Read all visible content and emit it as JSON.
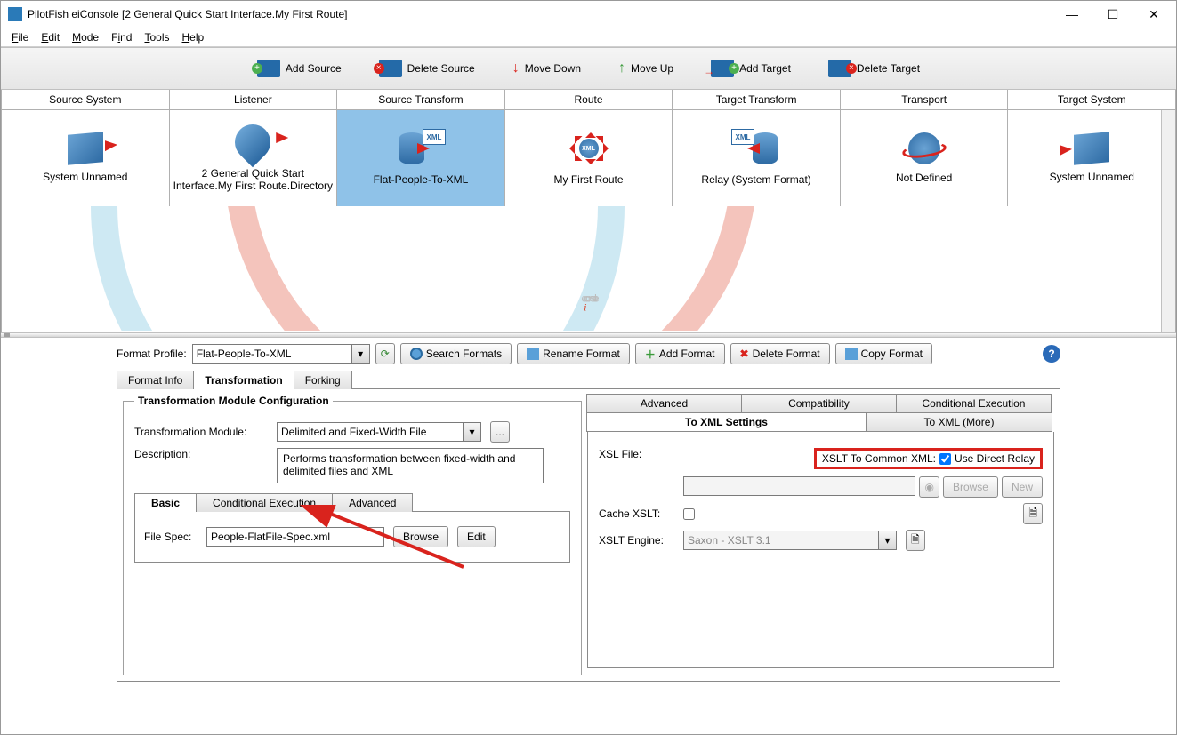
{
  "window": {
    "title": "PilotFish eiConsole [2 General Quick Start Interface.My First Route]"
  },
  "menu": {
    "file": "File",
    "edit": "Edit",
    "mode": "Mode",
    "find": "Find",
    "tools": "Tools",
    "help": "Help"
  },
  "toolbar": {
    "addSource": "Add Source",
    "deleteSource": "Delete Source",
    "moveDown": "Move Down",
    "moveUp": "Move Up",
    "addTarget": "Add Target",
    "deleteTarget": "Delete Target"
  },
  "stages": {
    "headers": [
      "Source System",
      "Listener",
      "Source Transform",
      "Route",
      "Target Transform",
      "Transport",
      "Target System"
    ],
    "cells": [
      "System Unnamed",
      "2 General Quick Start Interface.My First Route.Directory",
      "Flat-People-To-XML",
      "My First Route",
      "Relay (System Format)",
      "Not Defined",
      "System Unnamed"
    ],
    "selectedIndex": 2,
    "xmlBadge": "XML"
  },
  "watermark": {
    "pre": "e",
    "accent": "i",
    "post": "console"
  },
  "format": {
    "profileLabel": "Format Profile:",
    "profileValue": "Flat-People-To-XML",
    "searchFormats": "Search Formats",
    "renameFormat": "Rename Format",
    "addFormat": "Add Format",
    "deleteFormat": "Delete Format",
    "copyFormat": "Copy Format"
  },
  "leftTabs": {
    "formatInfo": "Format Info",
    "transformation": "Transformation",
    "forking": "Forking"
  },
  "transformConfig": {
    "legend": "Transformation Module Configuration",
    "moduleLabel": "Transformation Module:",
    "moduleValue": "Delimited and Fixed-Width File",
    "ellipsis": "...",
    "descLabel": "Description:",
    "descValue": "Performs transformation between fixed-width and delimited files and XML",
    "subtabs": {
      "basic": "Basic",
      "conditional": "Conditional Execution",
      "advanced": "Advanced"
    },
    "fileSpecLabel": "File Spec:",
    "fileSpecValue": "People-FlatFile-Spec.xml",
    "browse": "Browse",
    "edit": "Edit"
  },
  "rightTabs": {
    "advanced": "Advanced",
    "compatibility": "Compatibility",
    "conditionalExecution": "Conditional Execution",
    "toXmlSettings": "To XML Settings",
    "toXmlMore": "To XML (More)"
  },
  "xslPanel": {
    "xslFileLabel": "XSL File:",
    "xsltToCommon": "XSLT To Common XML:",
    "useDirectRelay": "Use Direct Relay",
    "useDirectRelayChecked": true,
    "pathValue": "",
    "browse": "Browse",
    "new": "New",
    "cacheXsltLabel": "Cache XSLT:",
    "cacheXsltChecked": false,
    "xsltEngineLabel": "XSLT Engine:",
    "xsltEngineValue": "Saxon - XSLT 3.1"
  }
}
